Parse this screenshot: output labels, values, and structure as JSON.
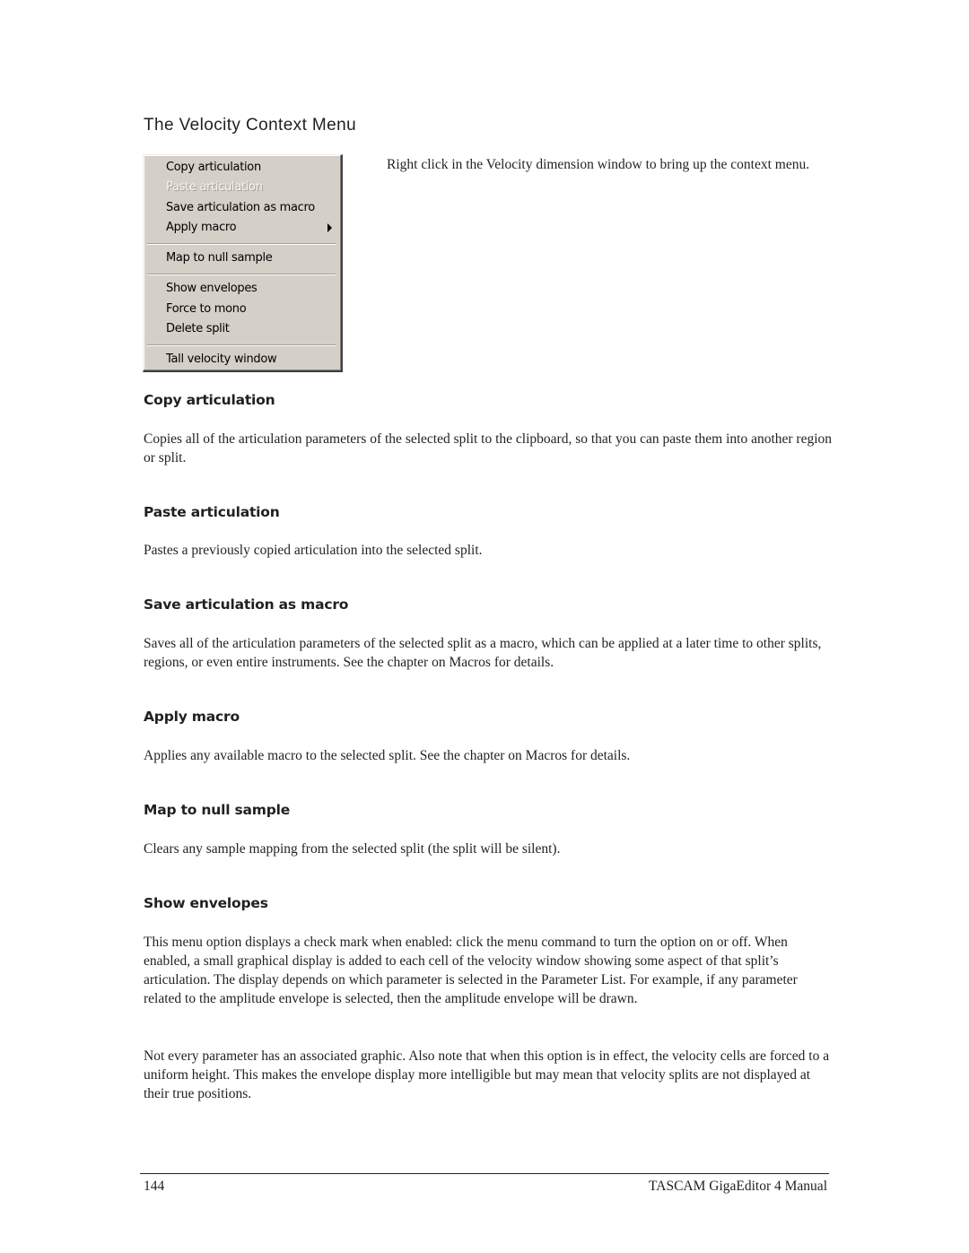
{
  "page": {
    "title": "The Velocity Context Menu",
    "intro": "Right click in the Velocity dimension window to bring up the context menu."
  },
  "context_menu": {
    "groups": [
      {
        "items": [
          {
            "label": "Copy articulation",
            "enabled": true,
            "submenu": false
          },
          {
            "label": "Paste articulation",
            "enabled": false,
            "submenu": false
          },
          {
            "label": "Save articulation as macro",
            "enabled": true,
            "submenu": false
          },
          {
            "label": "Apply macro",
            "enabled": true,
            "submenu": true
          }
        ]
      },
      {
        "items": [
          {
            "label": "Map to null sample",
            "enabled": true,
            "submenu": false
          }
        ]
      },
      {
        "items": [
          {
            "label": "Show envelopes",
            "enabled": true,
            "submenu": false
          },
          {
            "label": "Force to mono",
            "enabled": true,
            "submenu": false
          },
          {
            "label": "Delete split",
            "enabled": true,
            "submenu": false
          }
        ]
      },
      {
        "items": [
          {
            "label": "Tall velocity window",
            "enabled": true,
            "submenu": false
          }
        ]
      }
    ],
    "submenu_icon": "triangle-right-icon",
    "colors": {
      "background": "#d4d0c8",
      "disabled_text": "#f7f6f2"
    }
  },
  "sections": [
    {
      "heading": "Copy articulation",
      "paragraphs": [
        "Copies all of the articulation parameters of the selected split to the clipboard, so that you can paste them into another region or split."
      ]
    },
    {
      "heading": "Paste articulation",
      "paragraphs": [
        "Pastes a previously copied articulation into the selected split."
      ]
    },
    {
      "heading": "Save articulation as macro",
      "paragraphs": [
        "Saves all of the articulation parameters of the selected split as a macro, which can be applied at a later time to other splits, regions, or even entire instruments.  See the chapter on Macros for details."
      ]
    },
    {
      "heading": "Apply macro",
      "paragraphs": [
        "Applies any available macro to the selected split.  See the chapter on Macros for details."
      ]
    },
    {
      "heading": "Map to null sample",
      "paragraphs": [
        "Clears any sample mapping from the selected split (the split will be silent)."
      ]
    },
    {
      "heading": "Show envelopes",
      "paragraphs": [
        "This menu option displays a check mark when enabled: click the menu command to turn the option on or off.  When enabled, a small graphical display is added to each cell of the velocity window showing some aspect of that split’s articulation.  The display depends on which parameter is selected in the Parameter List.  For example, if any parameter related to the amplitude envelope is selected, then the amplitude envelope will be drawn.",
        "Not every parameter has an associated graphic.  Also note that when this option is in effect, the velocity cells are forced to a uniform height.  This makes the envelope display more intelligible but may mean that velocity splits are not displayed at their true positions."
      ]
    }
  ],
  "footer": {
    "page_number": "144",
    "manual_title": "TASCAM GigaEditor 4 Manual"
  }
}
